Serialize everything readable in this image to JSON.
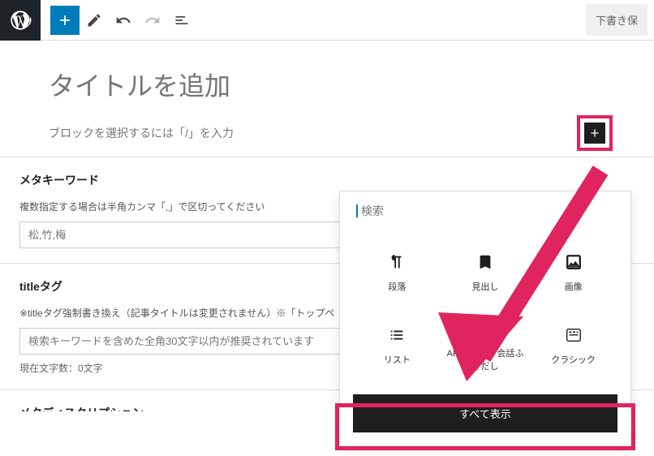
{
  "topbar": {
    "draft_save": "下書き保"
  },
  "editor": {
    "title_placeholder": "タイトルを追加",
    "block_prompt": "ブロックを選択するには「/」を入力"
  },
  "meta_keywords": {
    "title": "メタキーワード",
    "desc": "複数指定する場合は半角カンマ「,」で区切ってください",
    "placeholder": "松,竹,梅"
  },
  "title_tag": {
    "title": "titleタグ",
    "desc": "※titleタグ強制書き換え（記事タイトルは変更されません）※「トップペ",
    "placeholder": "検索キーワードを含めた全角30文字以内が推奨されています",
    "char_count": "現在文字数：0文字"
  },
  "truncated_section": {
    "title": "メタディスクリプション"
  },
  "inserter": {
    "search_placeholder": "検索",
    "blocks": [
      {
        "label": "段落",
        "icon": "paragraph"
      },
      {
        "label": "見出し",
        "icon": "bookmark"
      },
      {
        "label": "画像",
        "icon": "image"
      },
      {
        "label": "リスト",
        "icon": "list"
      },
      {
        "label": "AFFINGER: 会話ふきだし",
        "icon": "speech"
      },
      {
        "label": "クラシック",
        "icon": "classic"
      }
    ],
    "show_all": "すべて表示"
  }
}
